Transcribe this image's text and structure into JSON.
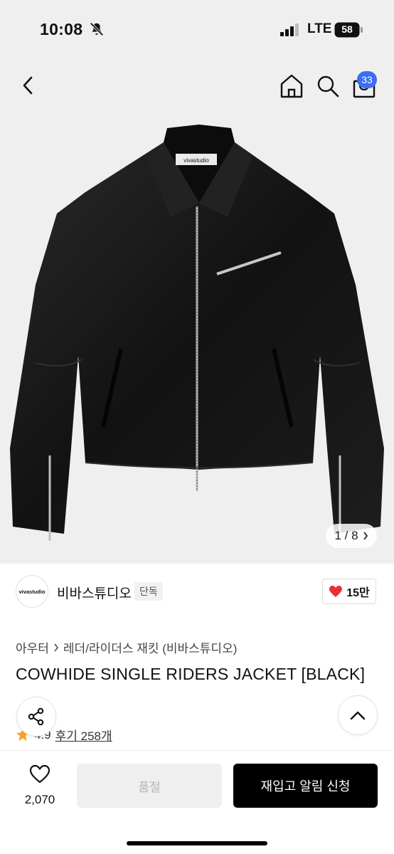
{
  "status_bar": {
    "time": "10:08",
    "network": "LTE",
    "battery": "58"
  },
  "header": {
    "cart_count": "33"
  },
  "gallery": {
    "counter": "1 / 8",
    "label_on_jacket": "vivastudio"
  },
  "brand": {
    "logo_text": "vivastudio",
    "name": "비바스튜디오",
    "badge": "단독",
    "likes": "15만"
  },
  "breadcrumb": {
    "level1": "아우터",
    "level2": "레더/라이더스 재킷 (비바스튜디오)"
  },
  "product": {
    "title": "COWHIDE SINGLE RIDERS JACKET [BLACK]"
  },
  "rating": {
    "value": "4.9",
    "reviews": "후기 258개"
  },
  "bottom_bar": {
    "wish_count": "2,070",
    "soldout_label": "품절",
    "restock_label": "재입고 알림 신청"
  },
  "colors": {
    "accent_blue": "#3b6ef5",
    "like_red": "#e8303a",
    "star": "#f5a623"
  }
}
